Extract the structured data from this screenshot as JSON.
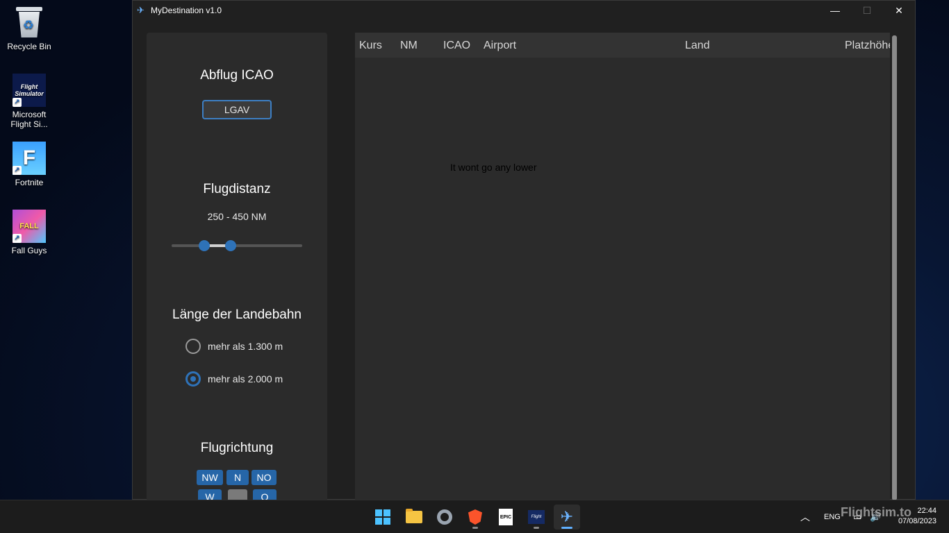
{
  "desktop": {
    "icons": [
      {
        "label": "Recycle Bin"
      },
      {
        "label": "Microsoft Flight Si..."
      },
      {
        "label": "Fortnite"
      },
      {
        "label": "Fall Guys"
      }
    ]
  },
  "window": {
    "title": "MyDestination v1.0",
    "controls": {
      "minimize": "—",
      "maximize": "☐",
      "close": "✕"
    }
  },
  "left_panel": {
    "departure_title": "Abflug ICAO",
    "departure_value": "LGAV",
    "distance_title": "Flugdistanz",
    "distance_value": "250 - 450 NM",
    "distance_slider": {
      "min_fraction": 0.25,
      "max_fraction": 0.45
    },
    "runway_title": "Länge der Landebahn",
    "runway_options": [
      {
        "label": "mehr als 1.300 m",
        "checked": false
      },
      {
        "label": "mehr als 2.000 m",
        "checked": true
      }
    ],
    "direction_title": "Flugrichtung",
    "directions": [
      "NW",
      "N",
      "NO",
      "W",
      "",
      "O"
    ]
  },
  "results_table": {
    "columns": [
      "Kurs",
      "NM",
      "ICAO",
      "Airport",
      "Land",
      "Platzhöhe"
    ]
  },
  "annotation": "It wont go any lower",
  "taskbar": {
    "language": "ENG",
    "time": "22:44",
    "date": "07/08/2023",
    "watermark": "Flightsim.to",
    "accent": "#60b0ff"
  }
}
